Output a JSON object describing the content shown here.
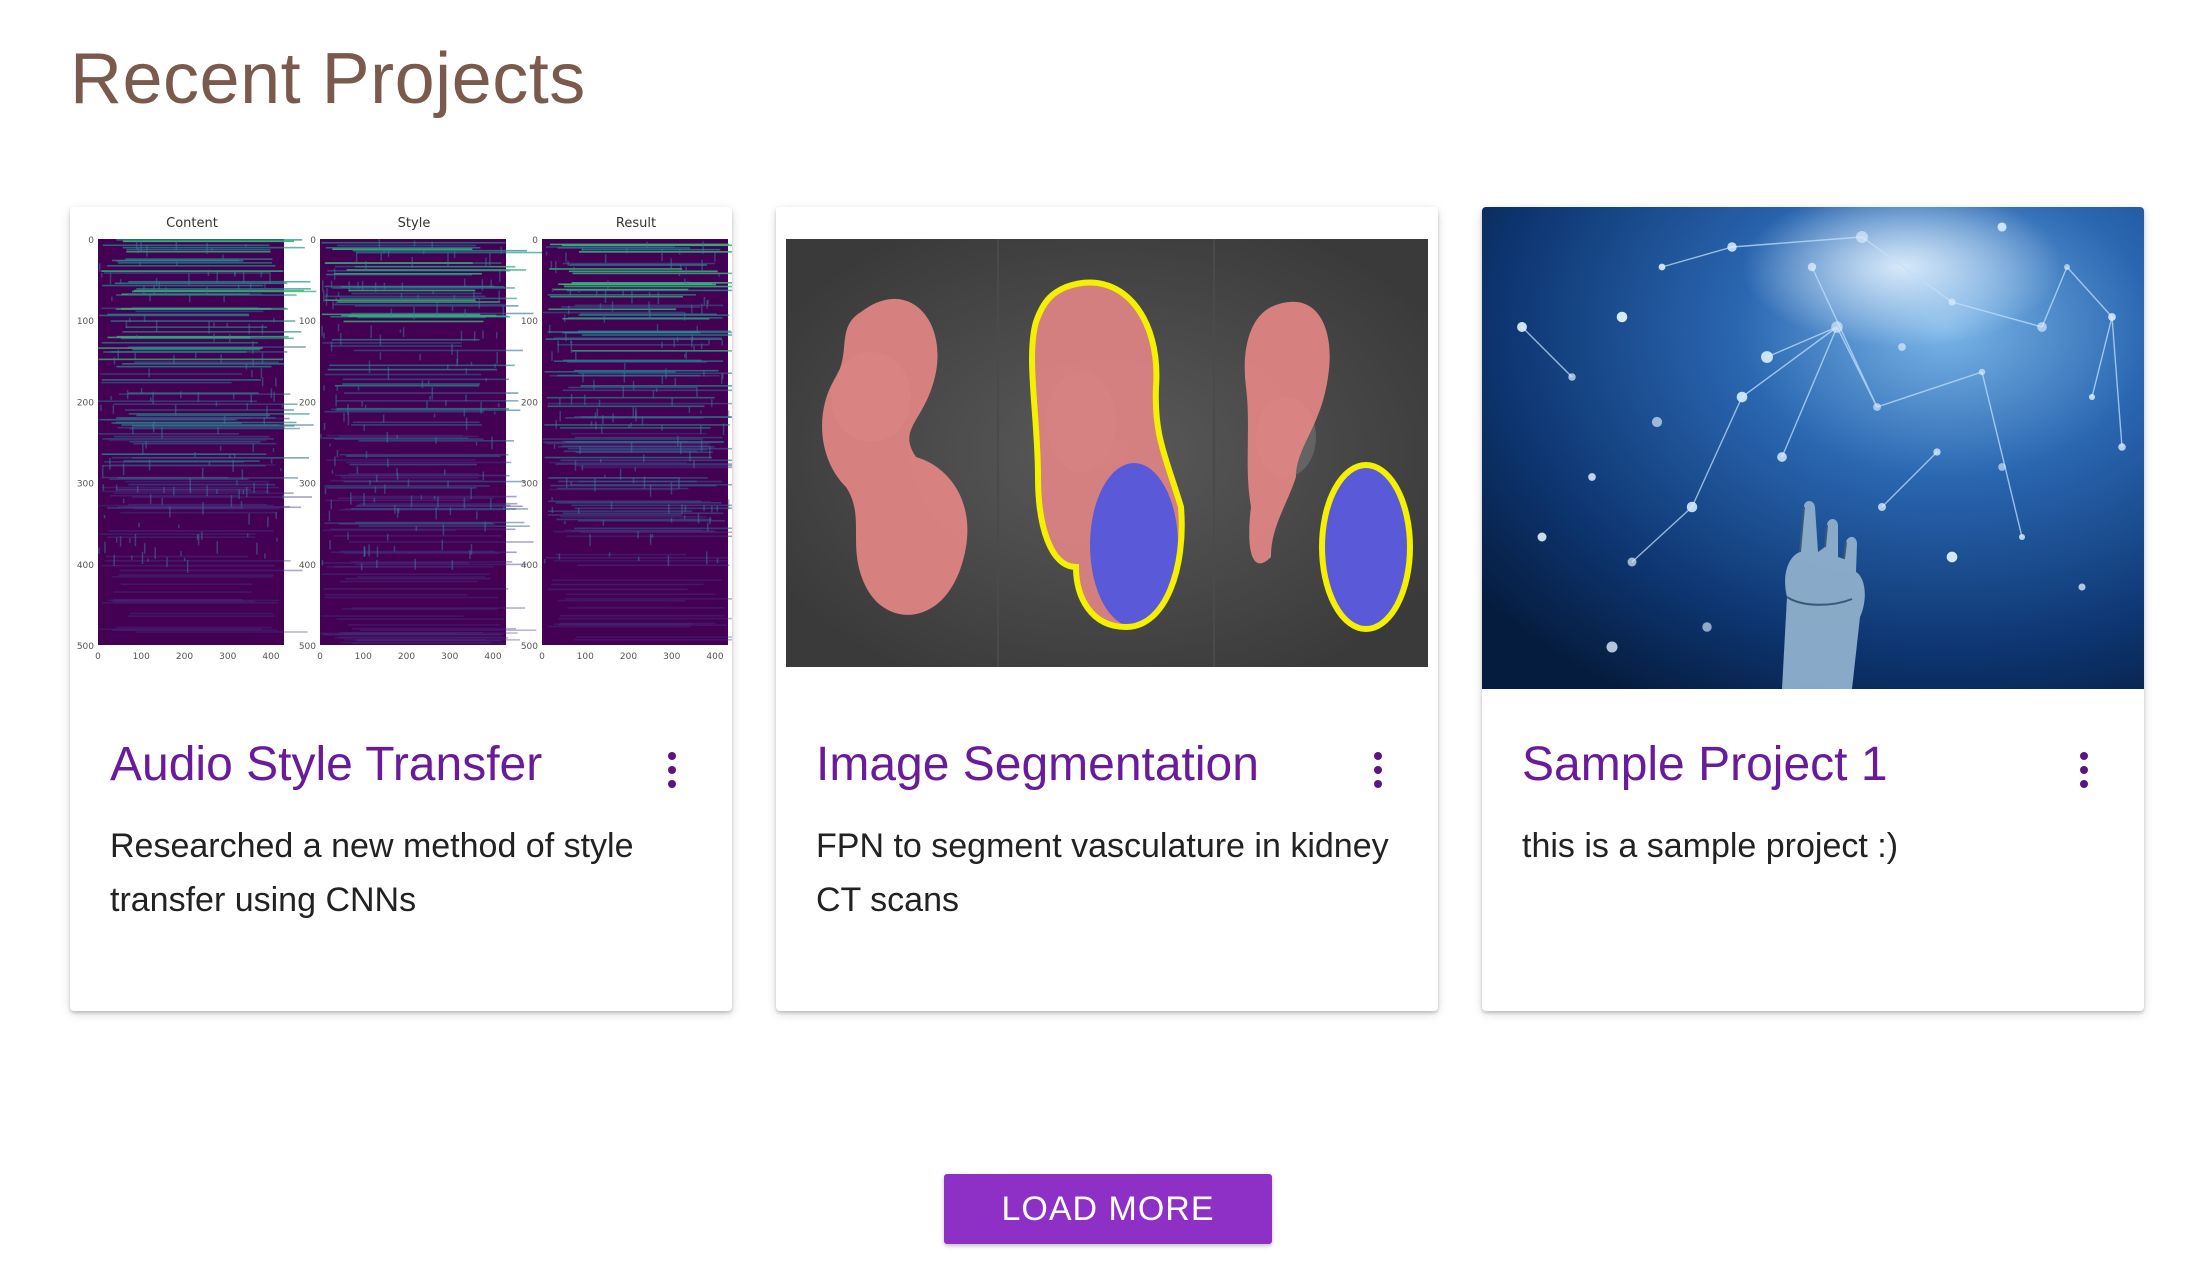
{
  "section": {
    "title": "Recent Projects"
  },
  "projects": [
    {
      "title": "Audio Style Transfer",
      "description": "Researched a new method of style transfer using CNNs",
      "image": {
        "panels": [
          "Content",
          "Style",
          "Result"
        ],
        "y_ticks": [
          "0",
          "100",
          "200",
          "300",
          "400",
          "500"
        ],
        "x_ticks": [
          "0",
          "100",
          "200",
          "300",
          "400"
        ]
      }
    },
    {
      "title": "Image Segmentation",
      "description": "FPN to segment vasculature in kidney CT scans"
    },
    {
      "title": "Sample Project 1",
      "description": "this is a sample project :)"
    }
  ],
  "menu_icon": "more-vert-icon",
  "load_more_label": "LOAD MORE",
  "colors": {
    "title": "#7a5a4c",
    "card_title": "#6a1b9a",
    "accent": "#8e2fc6",
    "viridis_dark": "#440154",
    "seg_red": "#e08080",
    "seg_blue": "#5a5ad8",
    "seg_outline": "#f5f000",
    "network_bg": "#0b2b57"
  }
}
